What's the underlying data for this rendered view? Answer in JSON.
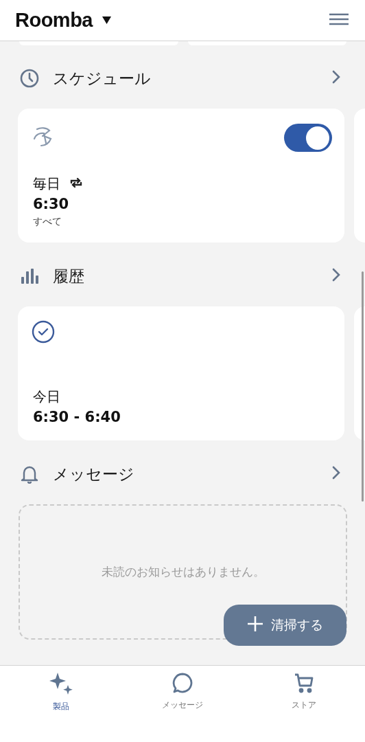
{
  "header": {
    "title": "Roomba"
  },
  "sections": [
    {
      "kind": "schedule",
      "title": "スケジュール",
      "items": [
        {
          "enabled": true,
          "frequency": "毎日",
          "time": "6:30",
          "rooms": "すべて"
        }
      ]
    },
    {
      "kind": "history",
      "title": "履歴",
      "items": [
        {
          "day": "今日",
          "time_range": "6:30 - 6:40"
        }
      ]
    },
    {
      "kind": "messages",
      "title": "メッセージ",
      "empty_text": "未読のお知らせはありません。"
    }
  ],
  "fab": {
    "label": "清掃する"
  },
  "tabs": [
    {
      "label": "製品",
      "selected": true
    },
    {
      "label": "メッセージ",
      "selected": false
    },
    {
      "label": "ストア",
      "selected": false
    }
  ]
}
